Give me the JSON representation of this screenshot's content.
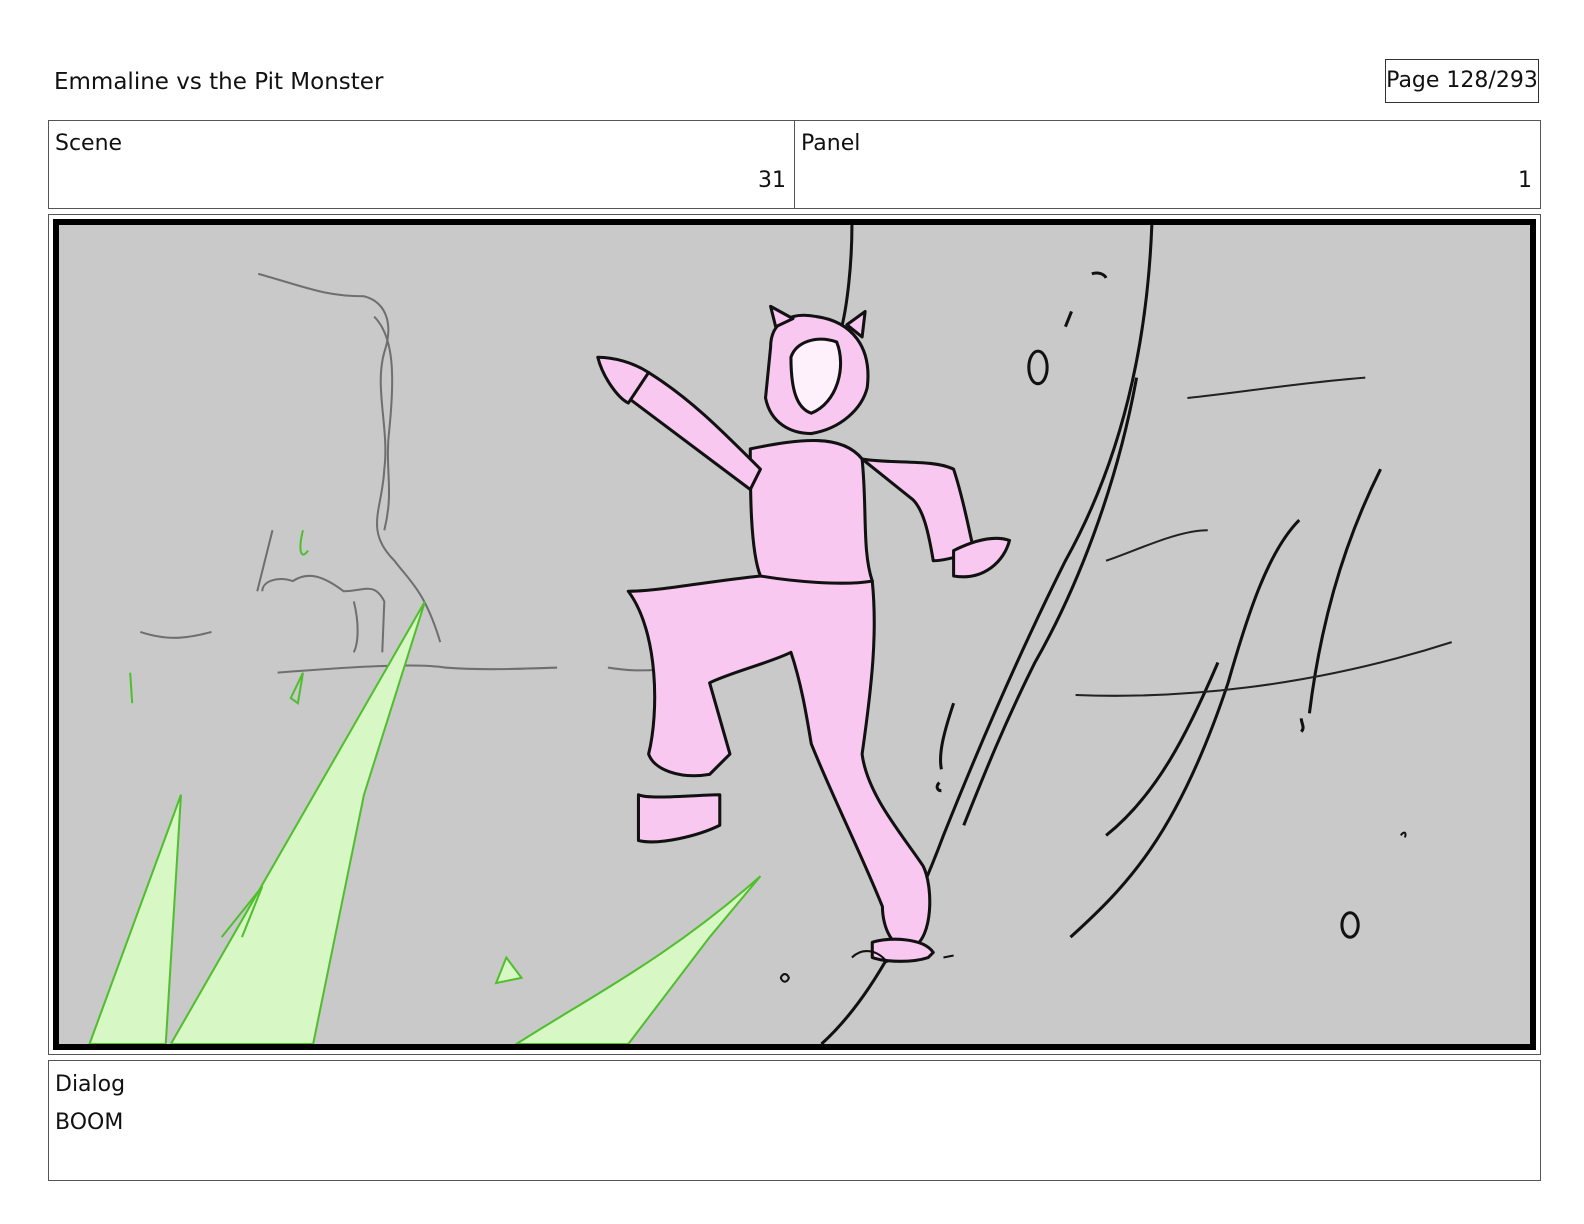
{
  "header": {
    "title": "Emmaline vs the Pit Monster",
    "page": "Page 128/293"
  },
  "scene": {
    "label": "Scene",
    "value": "31"
  },
  "panel": {
    "label": "Panel",
    "value": "1"
  },
  "frame": {
    "background": "#c9c9c9",
    "figure_color": "#f9c8f0",
    "energy_color": "#d7f7c4",
    "energy_line": "#4fbf2e"
  },
  "dialog": {
    "label": "Dialog",
    "text": "BOOM"
  }
}
